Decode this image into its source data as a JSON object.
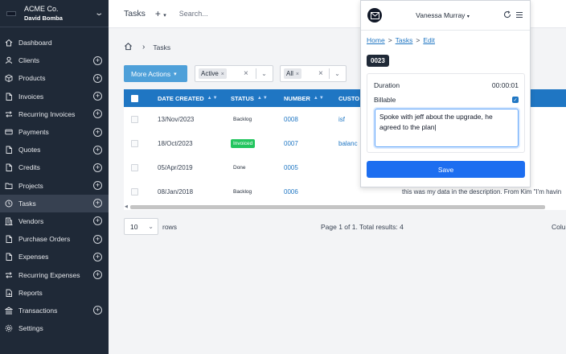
{
  "sidebar": {
    "company_name": "ACME Co.",
    "company_user": "David Bomba",
    "items": [
      {
        "label": "Dashboard",
        "icon": "home-icon",
        "plus": false
      },
      {
        "label": "Clients",
        "icon": "users-icon",
        "plus": true
      },
      {
        "label": "Products",
        "icon": "box-icon",
        "plus": true
      },
      {
        "label": "Invoices",
        "icon": "file-icon",
        "plus": true
      },
      {
        "label": "Recurring Invoices",
        "icon": "repeat-icon",
        "plus": true
      },
      {
        "label": "Payments",
        "icon": "credit-card-icon",
        "plus": true
      },
      {
        "label": "Quotes",
        "icon": "file-icon",
        "plus": true
      },
      {
        "label": "Credits",
        "icon": "file-icon",
        "plus": true
      },
      {
        "label": "Projects",
        "icon": "folder-icon",
        "plus": true
      },
      {
        "label": "Tasks",
        "icon": "clock-icon",
        "plus": true
      },
      {
        "label": "Vendors",
        "icon": "building-icon",
        "plus": true
      },
      {
        "label": "Purchase Orders",
        "icon": "file-icon",
        "plus": true
      },
      {
        "label": "Expenses",
        "icon": "file-icon",
        "plus": true
      },
      {
        "label": "Recurring Expenses",
        "icon": "repeat-icon",
        "plus": true
      },
      {
        "label": "Reports",
        "icon": "chart-icon",
        "plus": false
      },
      {
        "label": "Transactions",
        "icon": "bank-icon",
        "plus": true
      },
      {
        "label": "Settings",
        "icon": "gear-icon",
        "plus": false
      }
    ],
    "active_item": "Tasks"
  },
  "topbar": {
    "title": "Tasks",
    "search_placeholder": "Search..."
  },
  "breadcrumb": {
    "current": "Tasks"
  },
  "filters": {
    "more_actions": "More Actions",
    "status_tag": "Active",
    "client_tag": "All"
  },
  "table": {
    "columns": [
      "DATE CREATED",
      "STATUS",
      "NUMBER",
      "CUSTO"
    ],
    "rows": [
      {
        "date": "13/Nov/2023",
        "status": "Backlog",
        "status_style": "plain",
        "number": "0008",
        "client": "isf"
      },
      {
        "date": "18/Oct/2023",
        "status": "Invoiced",
        "status_style": "green",
        "number": "0007",
        "client": "balanc"
      },
      {
        "date": "05/Apr/2019",
        "status": "Done",
        "status_style": "plain",
        "number": "0005",
        "client": ""
      },
      {
        "date": "08/Jan/2018",
        "status": "Backlog",
        "status_style": "plain",
        "number": "0006",
        "client": ""
      }
    ],
    "background_description_text": "this was my data in the description. From Kim \"I'm havin"
  },
  "pagination": {
    "per_page": "10",
    "rows_label": "rows",
    "page_info": "Page 1 of 1. Total results: 4",
    "columns_label": "Colum"
  },
  "timer_popup": {
    "user": "Vanessa Murray",
    "crumbs": {
      "home": "Home",
      "tasks": "Tasks",
      "edit": "Edit"
    },
    "task_number": "0023",
    "duration_label": "Duration",
    "duration_value": "00:00:01",
    "billable_label": "Billable",
    "billable_checked": true,
    "description": "Spoke with jeff about the upgrade, he agreed to the plan",
    "save_label": "Save"
  },
  "colors": {
    "sidebar_bg": "#1f2937",
    "table_header": "#1f76c3",
    "more_actions_bg": "#4ea0d9",
    "save_button": "#1d6ef0",
    "invoiced_badge": "#22c55e"
  }
}
